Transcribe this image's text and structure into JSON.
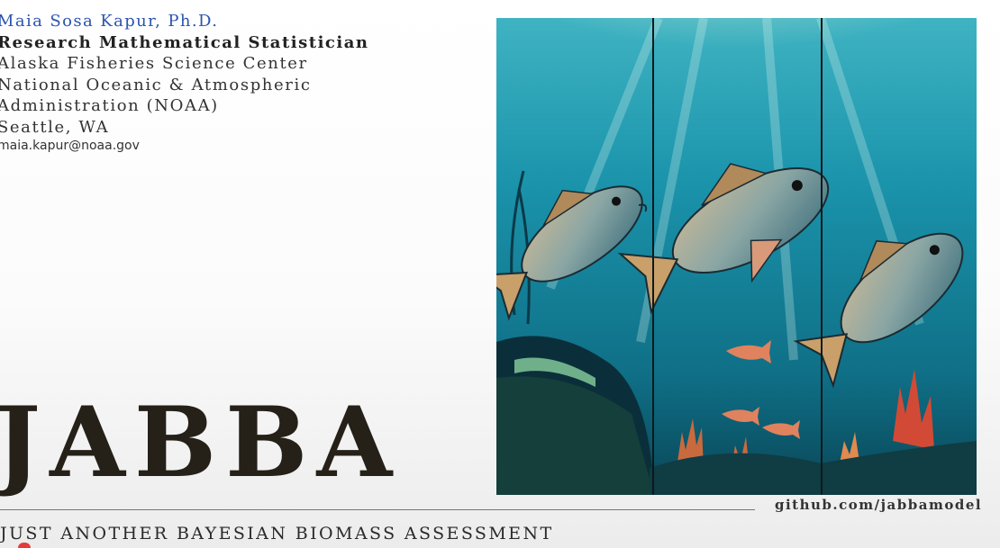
{
  "author": {
    "name": "Maia Sosa Kapur, Ph.D.",
    "title": "Research Mathematical Statistician",
    "affiliation_lines": [
      "Alaska Fisheries Science Center",
      "National Oceanic & Atmospheric",
      "Administration (NOAA)",
      "Seattle, WA"
    ],
    "email": "maia.kapur@noaa.gov"
  },
  "headline": "JABBA",
  "tagline": "JUST ANOTHER BAYESIAN BIOMASS ASSESSMENT",
  "link": "github.com/jabbamodel",
  "artwork": {
    "icon": "fish-illustration-triptych",
    "panels": 3,
    "colors": {
      "water": "#1e8fa6",
      "deep": "#0d4f63",
      "light": "#bfe8e0",
      "coral": "#d05a3a",
      "fish": "#8aa6a4"
    }
  },
  "colors": {
    "name": "#2a54b0",
    "text": "#1a1a1a",
    "headline": "#252018"
  }
}
